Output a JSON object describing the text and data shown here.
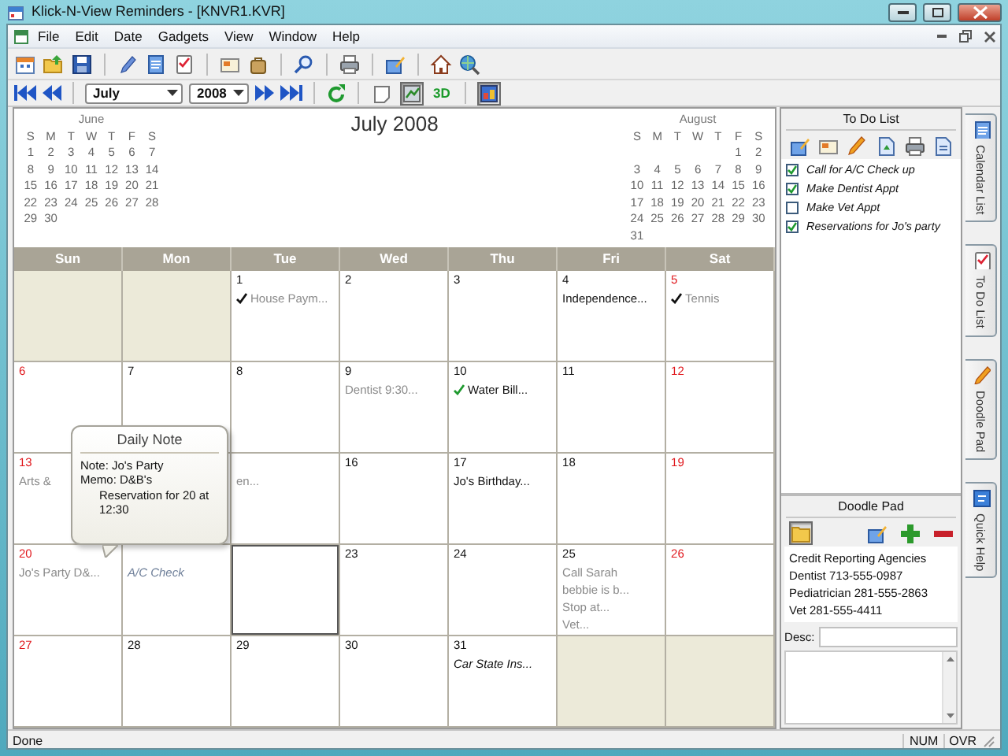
{
  "window": {
    "title": "Klick-N-View Reminders - [KNVR1.KVR]"
  },
  "menu": [
    "File",
    "Edit",
    "Date",
    "Gadgets",
    "View",
    "Window",
    "Help"
  ],
  "nav": {
    "month": "July",
    "year": "2008",
    "view_buttons": [
      {
        "selected": false
      },
      {
        "selected": true
      }
    ],
    "three_d": "3D"
  },
  "calendar": {
    "title": "July 2008",
    "mini_months": [
      {
        "name": "June",
        "weekdays": [
          "S",
          "M",
          "T",
          "W",
          "T",
          "F",
          "S"
        ],
        "weeks": [
          [
            "1",
            "2",
            "3",
            "4",
            "5",
            "6",
            "7"
          ],
          [
            "8",
            "9",
            "10",
            "11",
            "12",
            "13",
            "14"
          ],
          [
            "15",
            "16",
            "17",
            "18",
            "19",
            "20",
            "21"
          ],
          [
            "22",
            "23",
            "24",
            "25",
            "26",
            "27",
            "28"
          ],
          [
            "29",
            "30"
          ]
        ]
      },
      {
        "name": "August",
        "weekdays": [
          "S",
          "M",
          "T",
          "W",
          "T",
          "F",
          "S"
        ],
        "weeks": [
          [
            "1",
            "2"
          ],
          [
            "3",
            "4",
            "5",
            "6",
            "7",
            "8",
            "9"
          ],
          [
            "10",
            "11",
            "12",
            "13",
            "14",
            "15",
            "16"
          ],
          [
            "17",
            "18",
            "19",
            "20",
            "21",
            "22",
            "23"
          ],
          [
            "24",
            "25",
            "26",
            "27",
            "28",
            "29",
            "30"
          ],
          [
            "31"
          ]
        ]
      }
    ],
    "weekdays": [
      "Sun",
      "Mon",
      "Tue",
      "Wed",
      "Thu",
      "Fri",
      "Sat"
    ],
    "weeks": [
      [
        {
          "in_month": false,
          "selected": false
        },
        {
          "in_month": false,
          "selected": false
        },
        {
          "day": "1",
          "in_month": true,
          "selected": false,
          "events": [
            {
              "text": "House Paym...",
              "color": "#8a8a8a",
              "italic": false,
              "kind": "tick"
            }
          ]
        },
        {
          "day": "2",
          "in_month": true,
          "selected": false
        },
        {
          "day": "3",
          "in_month": true,
          "selected": false
        },
        {
          "day": "4",
          "in_month": true,
          "selected": false,
          "events": [
            {
              "text": "Independence...",
              "color": "#111111",
              "italic": false,
              "kind": "plain"
            }
          ]
        },
        {
          "day": "5",
          "in_month": true,
          "selected": false,
          "events": [
            {
              "text": "Tennis",
              "color": "#8a8a8a",
              "italic": false,
              "kind": "tick"
            }
          ]
        }
      ],
      [
        {
          "day": "6",
          "in_month": true,
          "selected": false
        },
        {
          "day": "7",
          "in_month": true,
          "selected": false
        },
        {
          "day": "8",
          "in_month": true,
          "selected": false
        },
        {
          "day": "9",
          "in_month": true,
          "selected": false,
          "events": [
            {
              "text": "Dentist 9:30...",
              "color": "#8a8a8a",
              "italic": false,
              "kind": "plain"
            }
          ]
        },
        {
          "day": "10",
          "in_month": true,
          "selected": false,
          "events": [
            {
              "text": "Water Bill...",
              "color": "#111111",
              "italic": false,
              "kind": "greentick"
            }
          ]
        },
        {
          "day": "11",
          "in_month": true,
          "selected": false
        },
        {
          "day": "12",
          "in_month": true,
          "selected": false
        }
      ],
      [
        {
          "day": "13",
          "in_month": true,
          "selected": false,
          "events": [
            {
              "text": "Arts &",
              "color": "#8a8a8a",
              "italic": false,
              "kind": "plain"
            }
          ]
        },
        {
          "in_month": true,
          "selected": false
        },
        {
          "in_month": true,
          "selected": false,
          "events": [
            {
              "text": "en...",
              "color": "#8a8a8a",
              "italic": false,
              "kind": "plain"
            }
          ]
        },
        {
          "day": "16",
          "in_month": true,
          "selected": false
        },
        {
          "day": "17",
          "in_month": true,
          "selected": false,
          "events": [
            {
              "text": "Jo's Birthday...",
              "color": "#111111",
              "italic": false,
              "kind": "plain"
            }
          ]
        },
        {
          "day": "18",
          "in_month": true,
          "selected": false
        },
        {
          "day": "19",
          "in_month": true,
          "selected": false
        }
      ],
      [
        {
          "day": "20",
          "in_month": true,
          "selected": false,
          "events": [
            {
              "text": "Jo's Party D&...",
              "color": "#8a8a8a",
              "italic": false,
              "kind": "plain"
            }
          ]
        },
        {
          "in_month": true,
          "selected": false,
          "events": [
            {
              "text": "A/C Check",
              "color": "#6e7f99",
              "italic": true,
              "kind": "plain"
            }
          ]
        },
        {
          "in_month": true,
          "selected": true
        },
        {
          "day": "23",
          "in_month": true,
          "selected": false
        },
        {
          "day": "24",
          "in_month": true,
          "selected": false
        },
        {
          "day": "25",
          "in_month": true,
          "selected": false,
          "events": [
            {
              "text": "Call Sarah",
              "color": "#8a8a8a",
              "italic": false,
              "kind": "plain"
            },
            {
              "text": "bebbie is b...",
              "color": "#8a8a8a",
              "italic": false,
              "kind": "plain"
            },
            {
              "text": "Stop at...",
              "color": "#8a8a8a",
              "italic": false,
              "kind": "plain"
            },
            {
              "text": "Vet...",
              "color": "#8a8a8a",
              "italic": false,
              "kind": "plain"
            }
          ]
        },
        {
          "day": "26",
          "in_month": true,
          "selected": false
        }
      ],
      [
        {
          "day": "27",
          "in_month": true,
          "selected": false
        },
        {
          "day": "28",
          "in_month": true,
          "selected": false
        },
        {
          "day": "29",
          "in_month": true,
          "selected": false
        },
        {
          "day": "30",
          "in_month": true,
          "selected": false
        },
        {
          "day": "31",
          "in_month": true,
          "selected": false,
          "events": [
            {
              "text": "Car State Ins...",
              "color": "#111111",
              "italic": true,
              "kind": "plain"
            }
          ]
        },
        {
          "in_month": false,
          "selected": false
        },
        {
          "in_month": false,
          "selected": false
        }
      ]
    ]
  },
  "daily_note": {
    "title": "Daily Note",
    "lines": [
      {
        "text": "Note: Jo's Party",
        "indent": false
      },
      {
        "text": "Memo: D&B's",
        "indent": false
      },
      {
        "text": "Reservation for 20 at 12:30",
        "indent": true
      }
    ]
  },
  "todo": {
    "title": "To Do List",
    "items": [
      {
        "text": "Call for A/C Check up",
        "checked": true
      },
      {
        "text": "Make Dentist Appt",
        "checked": true
      },
      {
        "text": "Make Vet Appt",
        "checked": false
      },
      {
        "text": "Reservations for Jo's party",
        "checked": true
      }
    ]
  },
  "doodle": {
    "title": "Doodle Pad",
    "lines": [
      "Credit Reporting Agencies",
      "Dentist 713-555-0987",
      "Pediatrician 281-555-2863",
      "Vet 281-555-4411"
    ],
    "desc_label": "Desc:"
  },
  "side_tabs": [
    "Calendar List",
    "To Do List",
    "Doodle Pad",
    "Quick Help"
  ],
  "status_bar": {
    "text": "Done",
    "indicators": [
      "NUM",
      "OVR"
    ]
  }
}
